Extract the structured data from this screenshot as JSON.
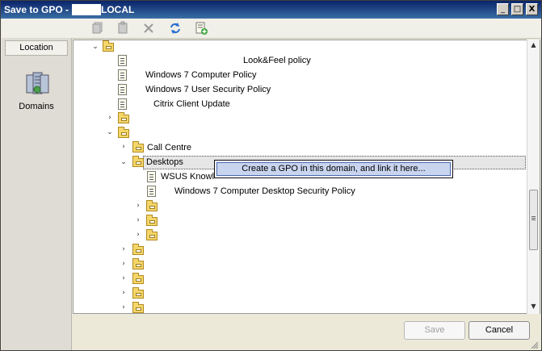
{
  "window": {
    "title_prefix": "Save to GPO - ",
    "title_suffix": "LOCAL",
    "controls": {
      "minimize": "_",
      "maximize": "□",
      "close": "X"
    }
  },
  "toolbar": {
    "tools": [
      "copy-gpo-icon",
      "paste-gpo-icon",
      "delete-icon",
      "refresh-icon",
      "new-gpo-icon"
    ]
  },
  "sidebar": {
    "header": "Location",
    "domains_label": "Domains"
  },
  "tree": {
    "policy_1": "Look&Feel policy",
    "policy_2": "Windows 7 Computer Policy",
    "policy_3": "Windows 7 User Security Policy",
    "policy_4": "Citrix Client Update",
    "ou_call_centre": "Call Centre",
    "ou_desktops": "Desktops",
    "desktops_policy_1": "WSUS Knowl",
    "desktops_policy_2": "Windows 7 Computer Desktop Security Policy"
  },
  "context_menu": {
    "item": "Create a GPO in this domain, and link it here..."
  },
  "buttons": {
    "save": "Save",
    "cancel": "Cancel"
  },
  "colors": {
    "titlebar": "#0a246a",
    "selection_menu": "#c9d4ee",
    "folder": "#f5d66a"
  }
}
